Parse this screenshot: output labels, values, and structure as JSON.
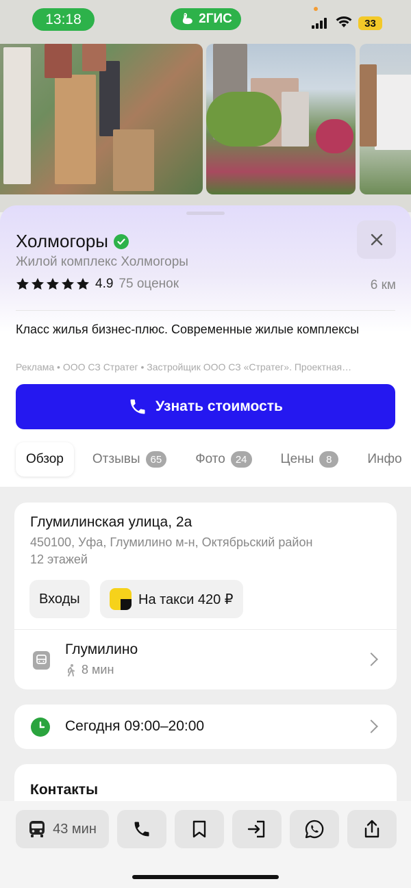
{
  "status_bar": {
    "time": "13:18",
    "app_logo": "2ГИС",
    "battery": "33"
  },
  "place": {
    "title": "Холмогоры",
    "subtitle": "Жилой комплекс Холмогоры",
    "rating": "4.9",
    "stars": 5,
    "reviews": "75 оценок",
    "distance": "6 км"
  },
  "ad": {
    "text": "Класс жилья бизнес-плюс. Современные жилые комплексы",
    "meta": "Реклама • ООО СЗ Стратег • Застройщик ООО СЗ «Стратег». Проектная…",
    "cta_label": "Узнать стоимость"
  },
  "tabs": [
    {
      "label": "Обзор",
      "badge": ""
    },
    {
      "label": "Отзывы",
      "badge": "65"
    },
    {
      "label": "Фото",
      "badge": "24"
    },
    {
      "label": "Цены",
      "badge": "8"
    },
    {
      "label": "Инфо",
      "badge": ""
    }
  ],
  "address": {
    "street": "Глумилинская улица, 2а",
    "city_line": "450100, Уфа, Глумилино м-н, Октябрьский район",
    "floors": "12 этажей",
    "entrances_label": "Входы",
    "taxi_label": "На такси 420 ₽"
  },
  "transit": {
    "stop_name": "Глумилино",
    "walk_time": "8 мин"
  },
  "hours": {
    "text": "Сегодня 09:00–20:00"
  },
  "contacts": {
    "title": "Контакты"
  },
  "bottom_bar": {
    "route_time": "43 мин"
  },
  "colors": {
    "brand_green": "#2db24a",
    "cta_blue": "#2518f0",
    "taxi_yellow": "#f6d21b"
  }
}
